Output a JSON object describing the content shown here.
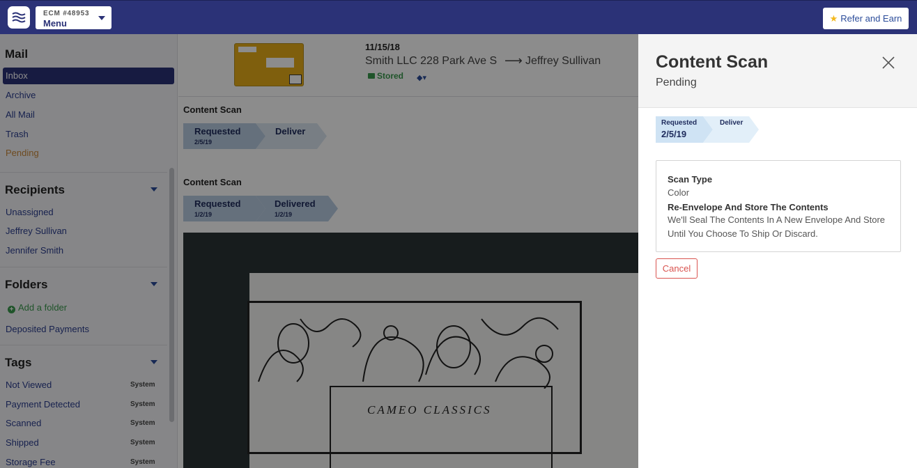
{
  "header": {
    "account": "ECM #48953",
    "menu_label": "Menu",
    "refer_label": "Refer and Earn"
  },
  "sidebar": {
    "mail_heading": "Mail",
    "mail_items": [
      "Inbox",
      "Archive",
      "All Mail",
      "Trash",
      "Pending"
    ],
    "recipients_heading": "Recipients",
    "recipients": [
      "Unassigned",
      "Jeffrey Sullivan",
      "Jennifer Smith"
    ],
    "folders_heading": "Folders",
    "add_folder": "Add a folder",
    "folders": [
      "Deposited Payments"
    ],
    "tags_heading": "Tags",
    "tags": [
      {
        "name": "Not Viewed",
        "badge": "System"
      },
      {
        "name": "Payment Detected",
        "badge": "System"
      },
      {
        "name": "Scanned",
        "badge": "System"
      },
      {
        "name": "Shipped",
        "badge": "System"
      },
      {
        "name": "Storage Fee",
        "badge": "System"
      }
    ]
  },
  "mail": {
    "date": "11/15/18",
    "from": "Smith LLC 228 Park Ave S",
    "to": "Jeffrey Sullivan",
    "status": "Stored",
    "scans": [
      {
        "title": "Content Scan",
        "steps": [
          {
            "name": "Requested",
            "date": "2/5/19"
          },
          {
            "name": "Deliver",
            "date": ""
          }
        ]
      },
      {
        "title": "Content Scan",
        "steps": [
          {
            "name": "Requested",
            "date": "1/2/19"
          },
          {
            "name": "Delivered",
            "date": "1/2/19"
          }
        ]
      }
    ],
    "document_text": "CAMEO CLASSICS"
  },
  "panel": {
    "title": "Content Scan",
    "subtitle": "Pending",
    "steps": [
      {
        "name": "Requested",
        "date": "2/5/19"
      },
      {
        "name": "Deliver",
        "date": ""
      }
    ],
    "scan_type_label": "Scan Type",
    "scan_type_value": "Color",
    "option_label": "Re-Envelope And Store The Contents",
    "option_desc": "We'll Seal The Contents In A New Envelope And Store Until You Choose To Ship Or Discard.",
    "cancel_label": "Cancel"
  },
  "colors": {
    "brand": "#2b3277",
    "link": "#2b3d8f",
    "success": "#3a9a4d",
    "danger": "#d9534f",
    "pending": "#c9883a"
  }
}
